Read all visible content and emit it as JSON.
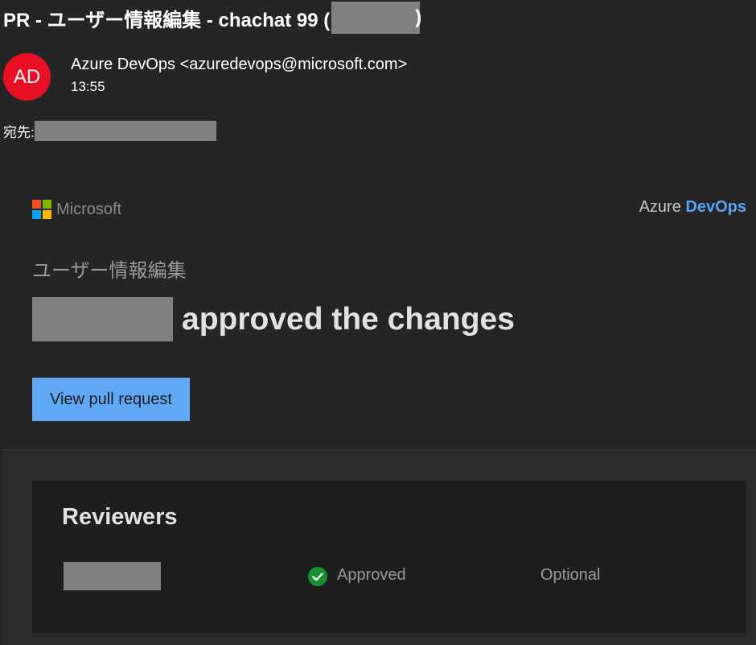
{
  "email": {
    "subject_prefix": "PR - ユーザー情報編集 - chachat 99 (",
    "subject_suffix": ")",
    "avatar_initials": "AD",
    "sender": "Azure DevOps <azuredevops@microsoft.com>",
    "time": "13:55",
    "to_label": "宛先:"
  },
  "body": {
    "microsoft_label": "Microsoft",
    "brand_azure": "Azure ",
    "brand_devops": "DevOps",
    "pr_title": "ユーザー情報編集",
    "headline": "approved the changes",
    "view_button_label": "View pull request",
    "reviewers_heading": "Reviewers",
    "reviewers": [
      {
        "status": "Approved",
        "required": "Optional"
      }
    ]
  },
  "colors": {
    "avatar": "#e81123",
    "button": "#60a8f5",
    "devops_accent": "#5aa3f0",
    "approved": "#1a8f2e",
    "redaction": "#808080"
  },
  "icons": {
    "approved": "check-circle-icon"
  }
}
